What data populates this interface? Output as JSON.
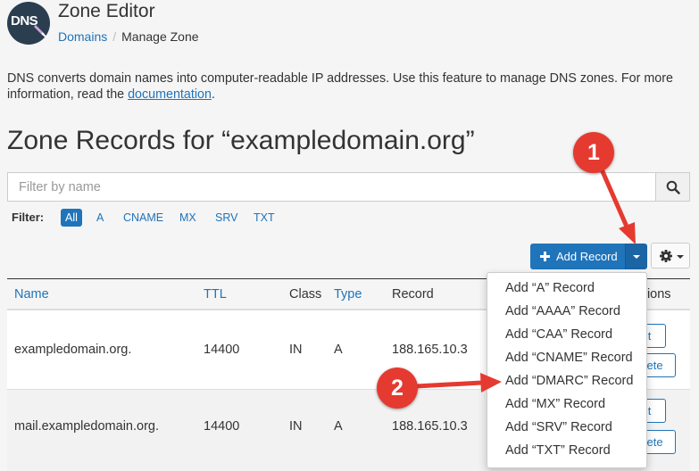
{
  "header": {
    "logo_text": "DNS",
    "title": "Zone Editor",
    "breadcrumb": {
      "root": "Domains",
      "separator": "/",
      "current": "Manage Zone"
    }
  },
  "intro": {
    "text_before_link": "DNS converts domain names into computer-readable IP addresses. Use this feature to manage DNS zones. For more information, read the ",
    "link_text": "documentation",
    "text_after_link": "."
  },
  "zone": {
    "heading": "Zone Records for “exampledomain.org”"
  },
  "search": {
    "placeholder": "Filter by name",
    "value": "",
    "icon": "search-icon"
  },
  "filter": {
    "label": "Filter:",
    "options": [
      "All",
      "A",
      "CNAME",
      "MX",
      "SRV",
      "TXT"
    ],
    "selected": "All"
  },
  "toolbar": {
    "add_record_label": "Add Record",
    "add_icon": "plus-icon",
    "gear_icon": "gear-icon"
  },
  "table": {
    "columns": {
      "name": "Name",
      "ttl": "TTL",
      "class": "Class",
      "type": "Type",
      "record": "Record",
      "actions": "Actions"
    },
    "rows": [
      {
        "name": "exampledomain.org.",
        "ttl": "14400",
        "class": "IN",
        "type": "A",
        "record": "188.165.10.3",
        "edit": "Edit",
        "delete": "Delete"
      },
      {
        "name": "mail.exampledomain.org.",
        "ttl": "14400",
        "class": "IN",
        "type": "A",
        "record": "188.165.10.3",
        "edit": "Edit",
        "delete": "Delete"
      }
    ]
  },
  "add_menu": {
    "items": [
      "Add “A” Record",
      "Add “AAAA” Record",
      "Add “CAA” Record",
      "Add “CNAME” Record",
      "Add “DMARC” Record",
      "Add “MX” Record",
      "Add “SRV” Record",
      "Add “TXT” Record"
    ]
  },
  "annotations": {
    "step1": "1",
    "step2": "2",
    "color": "#e53a30"
  },
  "colors": {
    "primary": "#1f74ba",
    "text": "#333333",
    "background": "#f5f5f5"
  }
}
